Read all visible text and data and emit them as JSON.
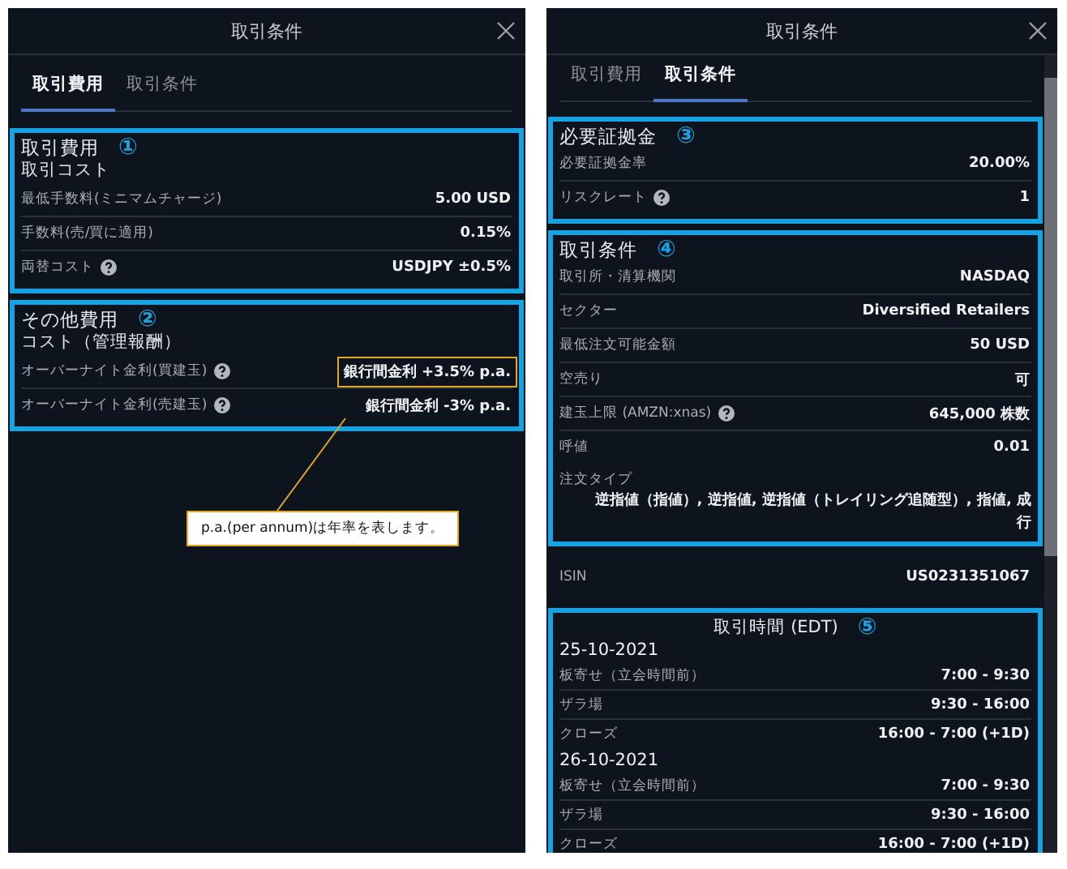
{
  "panels": [
    {
      "title": "取引条件",
      "tabs": [
        {
          "label": "取引費用",
          "selected": true
        },
        {
          "label": "取引条件",
          "selected": false
        }
      ],
      "note": "p.a.(per annum)は年率を表します。",
      "sections": [
        {
          "kind": "list",
          "outlined": true,
          "marker": "①",
          "title": "取引費用",
          "subtitle": "取引コスト",
          "rows": [
            {
              "kind": "row",
              "label": "最低手数料(ミニマムチャージ)",
              "value": "5.00 USD"
            },
            {
              "kind": "row",
              "label": "手数料(売/買に適用)",
              "value": "0.15%"
            },
            {
              "kind": "row",
              "label": "両替コスト",
              "value": "USDJPY ±0.5%",
              "help": true
            }
          ]
        },
        {
          "kind": "list",
          "outlined": true,
          "marker": "②",
          "title": "その他費用",
          "subtitle": "コスト（管理報酬）",
          "rows": [
            {
              "kind": "row",
              "label": "オーバーナイト金利(買建玉)",
              "value": "銀行間金利 +3.5% p.a.",
              "help": true,
              "callout": true
            },
            {
              "kind": "row",
              "label": "オーバーナイト金利(売建玉)",
              "value": "銀行間金利 -3% p.a.",
              "help": true
            }
          ]
        }
      ]
    },
    {
      "title": "取引条件",
      "tabs": [
        {
          "label": "取引費用",
          "selected": false
        },
        {
          "label": "取引条件",
          "selected": true
        }
      ],
      "scrollbar": true,
      "sections": [
        {
          "kind": "list",
          "outlined": true,
          "marker": "③",
          "title": "必要証拠金",
          "rows": [
            {
              "kind": "row",
              "label": "必要証拠金率",
              "value": "20.00%"
            },
            {
              "kind": "row",
              "label": "リスクレート",
              "value": "1",
              "help": true
            }
          ]
        },
        {
          "kind": "list",
          "outlined": true,
          "marker": "④",
          "title": "取引条件",
          "rows": [
            {
              "kind": "row",
              "label": "取引所・清算機関",
              "value": "NASDAQ"
            },
            {
              "kind": "row",
              "label": "セクター",
              "value": "Diversified Retailers"
            },
            {
              "kind": "row",
              "label": "最低注文可能金額",
              "value": "50 USD"
            },
            {
              "kind": "row",
              "label": "空売り",
              "value": "可"
            },
            {
              "kind": "row",
              "label": "建玉上限 (AMZN:xnas)",
              "value": "645,000 株数",
              "help": true
            },
            {
              "kind": "row",
              "label": "呼値",
              "value": "0.01"
            },
            {
              "kind": "wide",
              "label": "注文タイプ",
              "value": "逆指値（指値）, 逆指値, 逆指値（トレイリング追随型）, 指値, 成行"
            }
          ]
        },
        {
          "kind": "list",
          "outlined": false,
          "rows": [
            {
              "kind": "row",
              "label": "ISIN",
              "value": "US0231351067"
            }
          ]
        },
        {
          "kind": "schedule",
          "outlined": true,
          "marker": "⑤",
          "title": "取引時間 (EDT)",
          "rows": [
            {
              "kind": "date",
              "label": "25-10-2021"
            },
            {
              "kind": "row",
              "label": "板寄せ（立会時間前）",
              "value": "7:00 - 9:30"
            },
            {
              "kind": "row",
              "label": "ザラ場",
              "value": "9:30 - 16:00"
            },
            {
              "kind": "row",
              "label": "クローズ",
              "value": "16:00 - 7:00 (+1D)"
            },
            {
              "kind": "date",
              "label": "26-10-2021"
            },
            {
              "kind": "row",
              "label": "板寄せ（立会時間前）",
              "value": "7:00 - 9:30"
            },
            {
              "kind": "row",
              "label": "ザラ場",
              "value": "9:30 - 16:00"
            },
            {
              "kind": "row",
              "label": "クローズ",
              "value": "16:00 - 7:00 (+1D)"
            }
          ]
        }
      ]
    }
  ]
}
